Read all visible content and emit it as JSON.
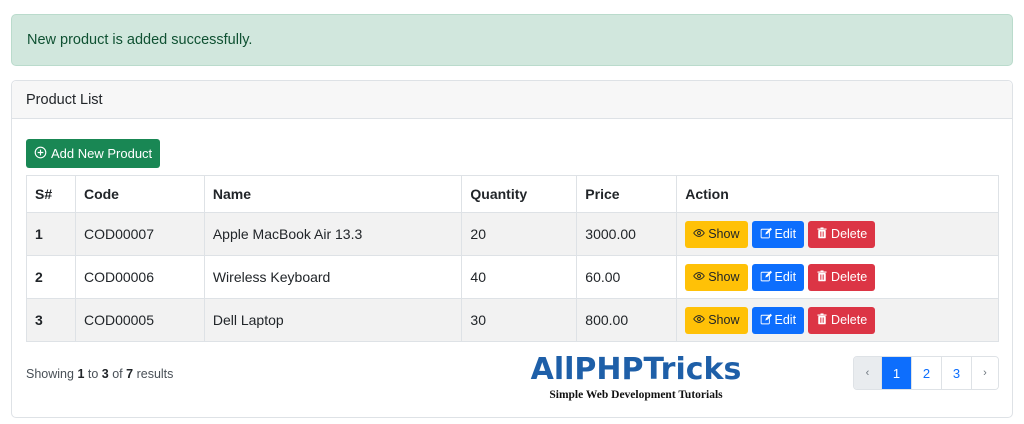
{
  "alert": {
    "message": "New product is added successfully."
  },
  "card": {
    "title": "Product List"
  },
  "add_button": {
    "label": "Add New Product"
  },
  "table": {
    "headers": [
      "S#",
      "Code",
      "Name",
      "Quantity",
      "Price",
      "Action"
    ],
    "rows": [
      {
        "sn": "1",
        "code": "COD00007",
        "name": "Apple MacBook Air 13.3",
        "quantity": "20",
        "price": "3000.00"
      },
      {
        "sn": "2",
        "code": "COD00006",
        "name": "Wireless Keyboard",
        "quantity": "40",
        "price": "60.00"
      },
      {
        "sn": "3",
        "code": "COD00005",
        "name": "Dell Laptop",
        "quantity": "30",
        "price": "800.00"
      }
    ],
    "actions": {
      "show": "Show",
      "edit": "Edit",
      "delete": "Delete"
    }
  },
  "summary": {
    "prefix": "Showing",
    "from": "1",
    "to_word": "to",
    "to": "3",
    "of_word": "of",
    "total": "7",
    "suffix": "results"
  },
  "watermark": {
    "title": "AllPHPTricks",
    "subtitle": "Simple Web Development Tutorials"
  },
  "pagination": {
    "prev": "‹",
    "pages": [
      "1",
      "2",
      "3"
    ],
    "next": "›",
    "active": "1"
  },
  "colors": {
    "success": "#198754",
    "primary": "#0d6efd",
    "warning": "#ffc107",
    "danger": "#dc3545",
    "alert_bg": "#d1e7dd"
  }
}
